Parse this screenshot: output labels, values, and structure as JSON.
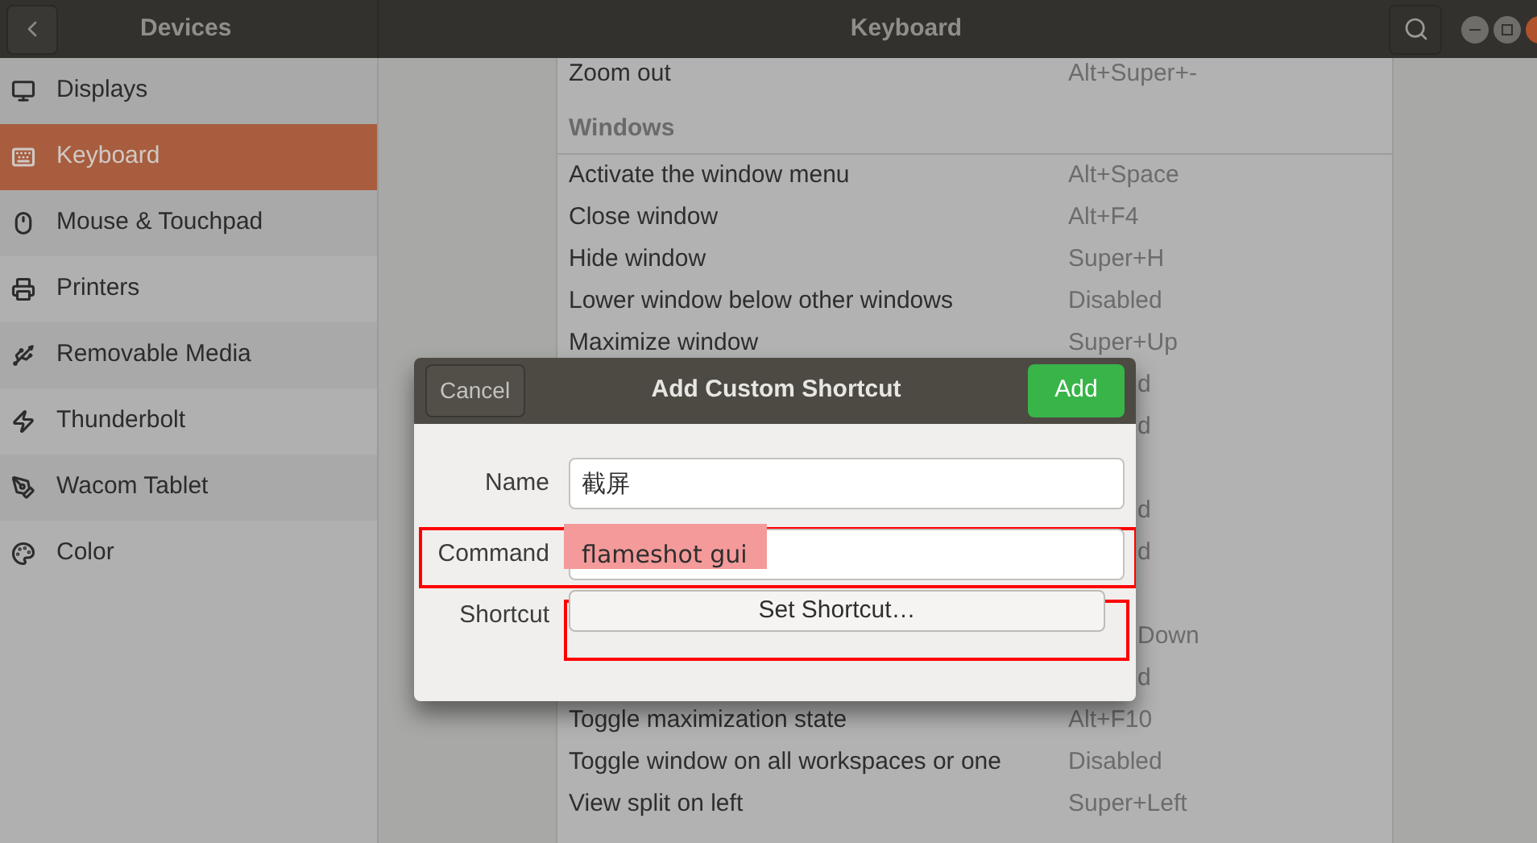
{
  "header": {
    "section_title": "Devices",
    "page_title": "Keyboard"
  },
  "sidebar": {
    "items": [
      {
        "label": "Displays",
        "selected": false
      },
      {
        "label": "Keyboard",
        "selected": true
      },
      {
        "label": "Mouse & Touchpad",
        "selected": false
      },
      {
        "label": "Printers",
        "selected": false
      },
      {
        "label": "Removable Media",
        "selected": false
      },
      {
        "label": "Thunderbolt",
        "selected": false
      },
      {
        "label": "Wacom Tablet",
        "selected": false
      },
      {
        "label": "Color",
        "selected": false
      }
    ]
  },
  "shortcuts": [
    {
      "kind": "row",
      "action": "Zoom out",
      "shortcut": "Alt+Super+-"
    },
    {
      "kind": "header",
      "action": "Windows"
    },
    {
      "kind": "row",
      "action": "Activate the window menu",
      "shortcut": "Alt+Space"
    },
    {
      "kind": "row",
      "action": "Close window",
      "shortcut": "Alt+F4"
    },
    {
      "kind": "row",
      "action": "Hide window",
      "shortcut": "Super+H"
    },
    {
      "kind": "row",
      "action": "Lower window below other windows",
      "shortcut": "Disabled"
    },
    {
      "kind": "row",
      "action": "Maximize window",
      "shortcut": "Super+Up"
    },
    {
      "kind": "partial",
      "shortcut": "d"
    },
    {
      "kind": "partial",
      "shortcut": "d"
    },
    {
      "kind": "partial"
    },
    {
      "kind": "partial",
      "shortcut": "d"
    },
    {
      "kind": "partial",
      "shortcut": "d"
    },
    {
      "kind": "partial"
    },
    {
      "kind": "partial",
      "shortcut": "Down"
    },
    {
      "kind": "partial",
      "shortcut": "d"
    },
    {
      "kind": "row",
      "action": "Toggle maximization state",
      "shortcut": "Alt+F10"
    },
    {
      "kind": "row",
      "action": "Toggle window on all workspaces or one",
      "shortcut": "Disabled"
    },
    {
      "kind": "row",
      "action": "View split on left",
      "shortcut": "Super+Left"
    }
  ],
  "dialog": {
    "title": "Add Custom Shortcut",
    "cancel": "Cancel",
    "add": "Add",
    "fields": [
      {
        "label": "Name",
        "value": "截屏",
        "highlighted": false
      },
      {
        "label": "Command",
        "value": "flameshot gui",
        "highlighted": true
      }
    ],
    "shortcut": {
      "label": "Shortcut",
      "button": "Set Shortcut…",
      "highlighted": true
    }
  }
}
